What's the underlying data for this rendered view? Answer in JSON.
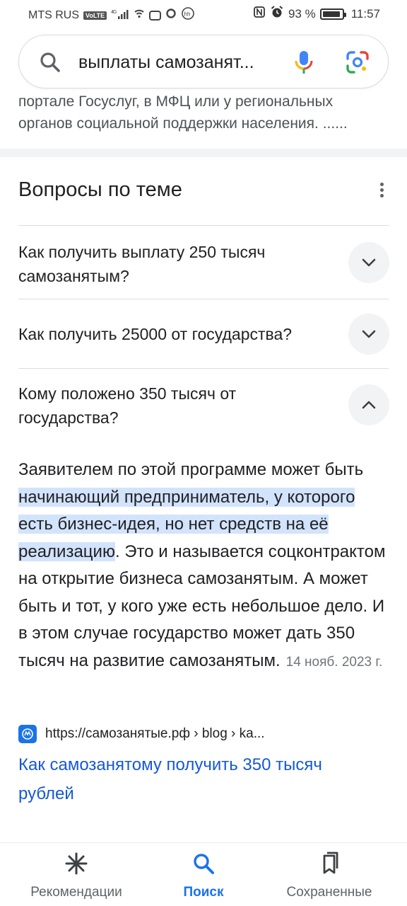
{
  "status_bar": {
    "carrier": "MTS RUS",
    "volte": "VoLTE",
    "network": "4G",
    "battery_percent": "93 %",
    "battery_level": 0.93,
    "time": "11:57"
  },
  "search": {
    "query": "выплаты самозанят...",
    "icons": {
      "search": "search-icon",
      "mic": "mic-icon",
      "lens": "google-lens-icon"
    }
  },
  "snippet_top": {
    "text": "портале Госуслуг, в МФЦ или у региональных органов социальной поддержки населения. ......"
  },
  "related_questions": {
    "title": "Вопросы по теме",
    "items": [
      {
        "question": "Как получить выплату 250 тысяч самозанятым?",
        "expanded": false
      },
      {
        "question": "Как получить 25000 от государства?",
        "expanded": false
      },
      {
        "question": "Кому положено 350 тысяч от государства?",
        "expanded": true
      }
    ],
    "answer": {
      "text_before": "Заявителем по этой программе может быть ",
      "highlight": "начинающий предприниматель, у которого есть бизнес-идея, но нет средств на её реализацию",
      "text_after": ". Это и называется соцконтрактом на открытие бизнеса самозанятым. А может быть и тот, у кого уже есть небольшое дело. И в этом случае государство может дать 350 тысяч на развитие самозанятым.",
      "date": "14 нояб. 2023 г.",
      "source_url": "https://самозанятые.рф › blog › ka...",
      "link_title": "Как самозанятому получить 350 тысяч рублей"
    }
  },
  "bottom_nav": {
    "items": [
      {
        "label": "Рекомендации",
        "icon": "asterisk-icon",
        "active": false
      },
      {
        "label": "Поиск",
        "icon": "search-icon",
        "active": true
      },
      {
        "label": "Сохраненные",
        "icon": "bookmarks-icon",
        "active": false
      }
    ]
  },
  "colors": {
    "accent": "#1a73e8",
    "link": "#1558d6",
    "highlight": "#d2e3fc",
    "text": "#202124",
    "secondary_text": "#4d5156"
  }
}
